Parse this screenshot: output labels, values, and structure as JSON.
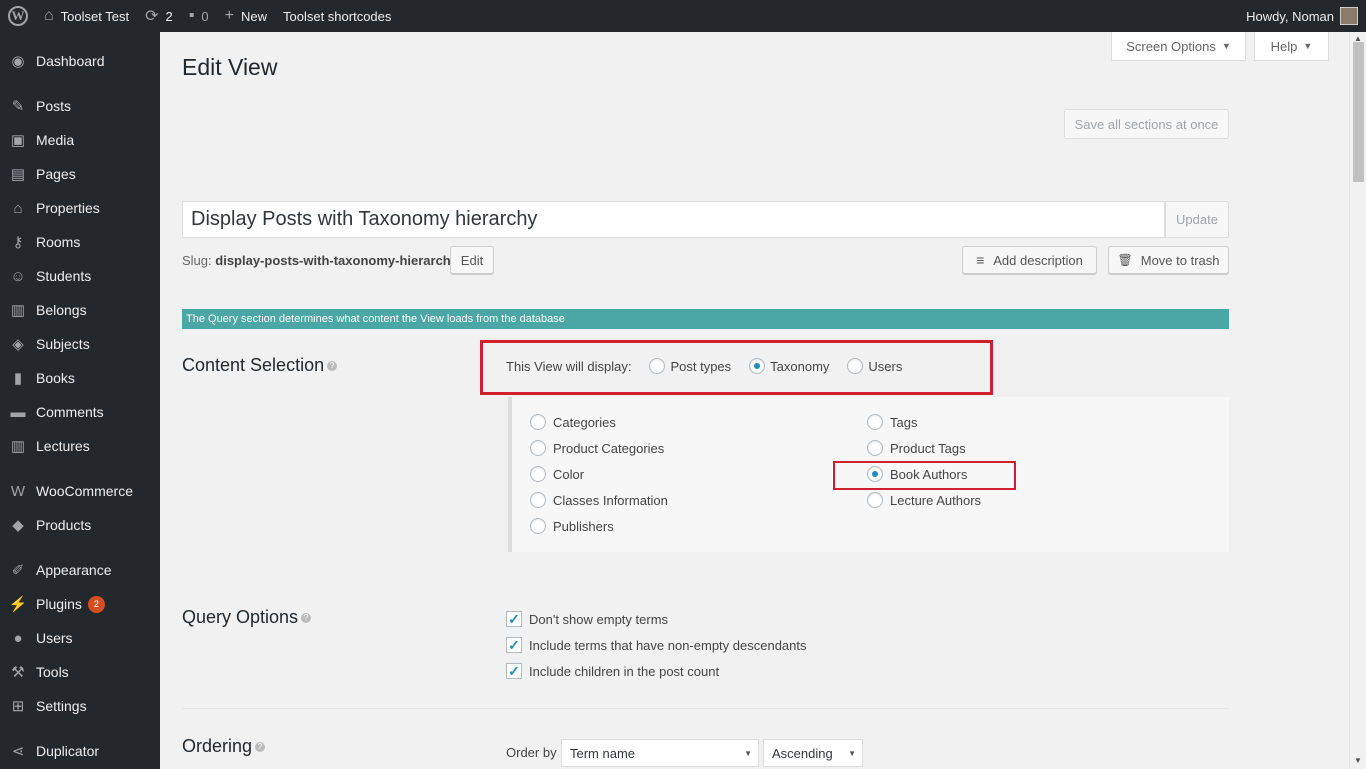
{
  "adminbar": {
    "site_name": "Toolset Test",
    "updates_count": "2",
    "comments_count": "0",
    "new_label": "New",
    "shortcodes_label": "Toolset shortcodes",
    "howdy": "Howdy, Noman"
  },
  "sidebar": {
    "items": [
      {
        "label": "Dashboard",
        "icon": "dashboard-icon"
      },
      {
        "label": "Posts",
        "icon": "pin-icon"
      },
      {
        "label": "Media",
        "icon": "media-icon"
      },
      {
        "label": "Pages",
        "icon": "page-icon"
      },
      {
        "label": "Properties",
        "icon": "home-icon"
      },
      {
        "label": "Rooms",
        "icon": "key-icon"
      },
      {
        "label": "Students",
        "icon": "universal-access-icon"
      },
      {
        "label": "Belongs",
        "icon": "document-icon"
      },
      {
        "label": "Subjects",
        "icon": "tags-icon"
      },
      {
        "label": "Books",
        "icon": "book-icon"
      },
      {
        "label": "Comments",
        "icon": "comment-icon"
      },
      {
        "label": "Lectures",
        "icon": "document-icon"
      },
      {
        "label": "WooCommerce",
        "icon": "woo-icon"
      },
      {
        "label": "Products",
        "icon": "box-icon"
      },
      {
        "label": "Appearance",
        "icon": "brush-icon"
      },
      {
        "label": "Plugins",
        "icon": "plugin-icon",
        "badge": "2"
      },
      {
        "label": "Users",
        "icon": "user-icon"
      },
      {
        "label": "Tools",
        "icon": "wrench-icon"
      },
      {
        "label": "Settings",
        "icon": "settings-icon"
      },
      {
        "label": "Duplicator",
        "icon": "share-icon"
      }
    ]
  },
  "header": {
    "screen_options": "Screen Options",
    "help": "Help",
    "title": "Edit View",
    "save_all": "Save all sections at once"
  },
  "view": {
    "title": "Display Posts with Taxonomy hierarchy",
    "update": "Update",
    "slug_label": "Slug:",
    "slug": "display-posts-with-taxonomy-hierarchy",
    "edit": "Edit",
    "add_description": "Add description",
    "move_to_trash": "Move to trash"
  },
  "info_bar": "The Query section determines what content the View loads from the database",
  "content_selection": {
    "title": "Content Selection",
    "display_label": "This View will display:",
    "options": [
      {
        "label": "Post types",
        "checked": false
      },
      {
        "label": "Taxonomy",
        "checked": true
      },
      {
        "label": "Users",
        "checked": false
      }
    ],
    "taxonomies": [
      {
        "label": "Categories",
        "checked": false
      },
      {
        "label": "Product Categories",
        "checked": false
      },
      {
        "label": "Color",
        "checked": false
      },
      {
        "label": "Classes Information",
        "checked": false
      },
      {
        "label": "Publishers",
        "checked": false
      },
      {
        "label": "Tags",
        "checked": false
      },
      {
        "label": "Product Tags",
        "checked": false
      },
      {
        "label": "Book Authors",
        "checked": true
      },
      {
        "label": "Lecture Authors",
        "checked": false
      }
    ]
  },
  "query_options": {
    "title": "Query Options",
    "items": [
      {
        "label": "Don't show empty terms",
        "checked": true
      },
      {
        "label": "Include terms that have non-empty descendants",
        "checked": true
      },
      {
        "label": "Include children in the post count",
        "checked": true
      }
    ]
  },
  "ordering": {
    "title": "Ordering",
    "order_by_label": "Order by",
    "order_by_value": "Term name",
    "direction_value": "Ascending"
  },
  "colors": {
    "adminbar_bg": "#23282d",
    "info_bar": "#4ba6a6",
    "highlight": "#d0202e",
    "radio_checked": "#1e8cbe",
    "badge": "#d54e21"
  }
}
